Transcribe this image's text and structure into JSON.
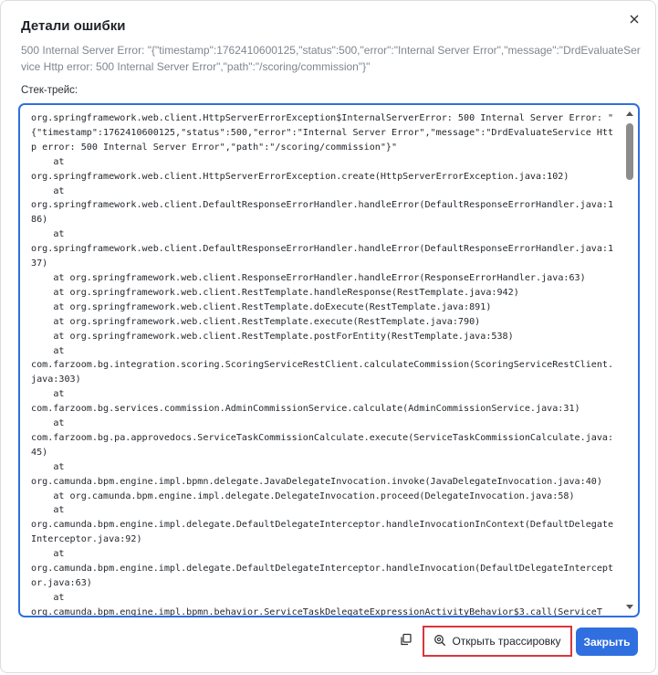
{
  "dialog": {
    "title": "Детали ошибки",
    "summary": "500 Internal Server Error: \"{\"timestamp\":1762410600125,\"status\":500,\"error\":\"Internal Server Error\",\"message\":\"DrdEvaluateService Http error: 500 Internal Server Error\",\"path\":\"/scoring/commission\"}\"",
    "stack_label": "Стек-трейс:",
    "stack_trace": "org.springframework.web.client.HttpServerErrorException$InternalServerError: 500 Internal Server Error: \"{\"timestamp\":1762410600125,\"status\":500,\"error\":\"Internal Server Error\",\"message\":\"DrdEvaluateService Http error: 500 Internal Server Error\",\"path\":\"/scoring/commission\"}\"\n    at\norg.springframework.web.client.HttpServerErrorException.create(HttpServerErrorException.java:102)\n    at\norg.springframework.web.client.DefaultResponseErrorHandler.handleError(DefaultResponseErrorHandler.java:186)\n    at\norg.springframework.web.client.DefaultResponseErrorHandler.handleError(DefaultResponseErrorHandler.java:137)\n    at org.springframework.web.client.ResponseErrorHandler.handleError(ResponseErrorHandler.java:63)\n    at org.springframework.web.client.RestTemplate.handleResponse(RestTemplate.java:942)\n    at org.springframework.web.client.RestTemplate.doExecute(RestTemplate.java:891)\n    at org.springframework.web.client.RestTemplate.execute(RestTemplate.java:790)\n    at org.springframework.web.client.RestTemplate.postForEntity(RestTemplate.java:538)\n    at\ncom.farzoom.bg.integration.scoring.ScoringServiceRestClient.calculateCommission(ScoringServiceRestClient.java:303)\n    at\ncom.farzoom.bg.services.commission.AdminCommissionService.calculate(AdminCommissionService.java:31)\n    at\ncom.farzoom.bg.pa.approvedocs.ServiceTaskCommissionCalculate.execute(ServiceTaskCommissionCalculate.java:45)\n    at\norg.camunda.bpm.engine.impl.bpmn.delegate.JavaDelegateInvocation.invoke(JavaDelegateInvocation.java:40)\n    at org.camunda.bpm.engine.impl.delegate.DelegateInvocation.proceed(DelegateInvocation.java:58)\n    at\norg.camunda.bpm.engine.impl.delegate.DefaultDelegateInterceptor.handleInvocationInContext(DefaultDelegateInterceptor.java:92)\n    at\norg.camunda.bpm.engine.impl.delegate.DefaultDelegateInterceptor.handleInvocation(DefaultDelegateInterceptor.java:63)\n    at\norg.camunda.bpm.engine.impl.bpmn.behavior.ServiceTaskDelegateExpressionActivityBehavior$3.call(ServiceT",
    "icons": {
      "close": "close-icon",
      "copy": "copy-icon",
      "trace": "search-trace-icon"
    },
    "buttons": {
      "open_trace": "Открыть трассировку",
      "close": "Закрыть"
    },
    "colors": {
      "accent": "#2f6fe0",
      "highlight_border": "#d9363e",
      "summary_text": "#7f868f"
    }
  }
}
